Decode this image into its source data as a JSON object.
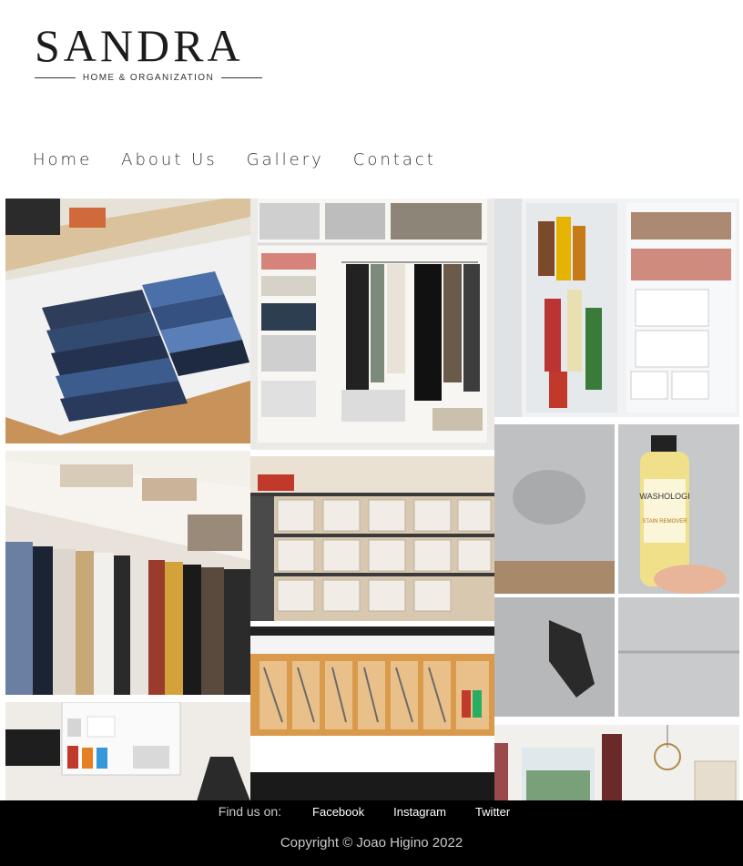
{
  "brand": {
    "name": "SANDRA",
    "tagline": "HOME & ORGANIZATION"
  },
  "nav": [
    {
      "label": "Home"
    },
    {
      "label": "About Us"
    },
    {
      "label": "Gallery"
    },
    {
      "label": "Contact"
    }
  ],
  "gallery": {
    "photos": [
      {
        "subject": "drawer-jeans-photo"
      },
      {
        "subject": "wardrobe-shelves-photo"
      },
      {
        "subject": "fridge-door-photo"
      },
      {
        "subject": "closet-hanging-clothes-photo"
      },
      {
        "subject": "storage-bins-shelf-photo"
      },
      {
        "subject": "stain-remover-sofa-photo"
      },
      {
        "subject": "cutlery-drawer-photo"
      },
      {
        "subject": "laundry-shelf-photo"
      },
      {
        "subject": "living-room-window-photo"
      }
    ]
  },
  "footer": {
    "find_us_label": "Find us on:",
    "links": [
      {
        "label": "Facebook"
      },
      {
        "label": "Instagram"
      },
      {
        "label": "Twitter"
      }
    ],
    "copyright": "Copyright © Joao Higino 2022"
  },
  "photo_texts": {
    "bottle_brand": "WASHOLOGI",
    "bottle_line": "STAIN REMOVER"
  },
  "colors": {
    "footer_bg": "#000000",
    "text": "#333333"
  }
}
